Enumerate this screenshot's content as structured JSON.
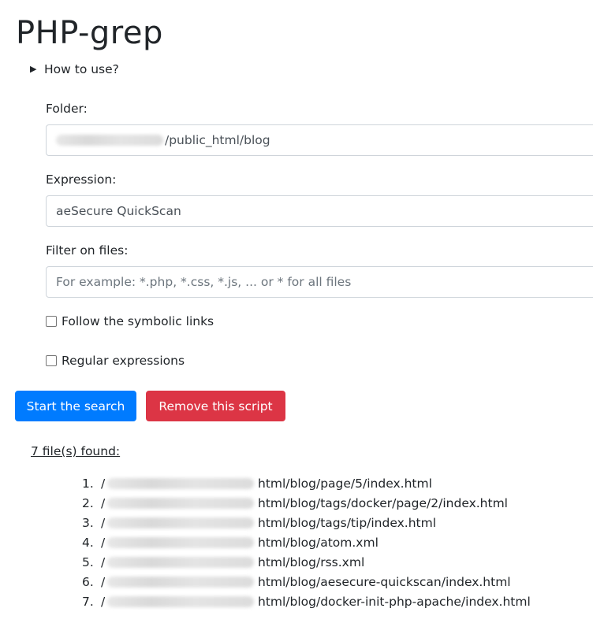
{
  "page": {
    "title": "PHP-grep",
    "how_to_use": "How to use?"
  },
  "form": {
    "folder": {
      "label": "Folder:",
      "value_visible": "/public_html/blog"
    },
    "expression": {
      "label": "Expression:",
      "value": "aeSecure QuickScan"
    },
    "filter": {
      "label": "Filter on files:",
      "placeholder": "For example: *.php, *.css, *.js, ... or * for all files"
    },
    "follow_symlinks": {
      "label": "Follow the symbolic links",
      "checked": false
    },
    "regex": {
      "label": "Regular expressions",
      "checked": false
    }
  },
  "buttons": {
    "search": "Start the search",
    "remove": "Remove this script"
  },
  "results": {
    "summary": "7 file(s) found:",
    "items": [
      {
        "num": "1.",
        "prefix": "/",
        "path": "html/blog/page/5/index.html"
      },
      {
        "num": "2.",
        "prefix": "/",
        "path": "html/blog/tags/docker/page/2/index.html"
      },
      {
        "num": "3.",
        "prefix": "/",
        "path": "html/blog/tags/tip/index.html"
      },
      {
        "num": "4.",
        "prefix": "/",
        "path": "html/blog/atom.xml"
      },
      {
        "num": "5.",
        "prefix": "/",
        "path": "html/blog/rss.xml"
      },
      {
        "num": "6.",
        "prefix": "/",
        "path": "html/blog/aesecure-quickscan/index.html"
      },
      {
        "num": "7.",
        "prefix": "/",
        "path": "html/blog/docker-init-php-apache/index.html"
      }
    ]
  },
  "colors": {
    "primary": "#007bff",
    "danger": "#dc3545",
    "text": "#212529",
    "border": "#ced4da"
  }
}
